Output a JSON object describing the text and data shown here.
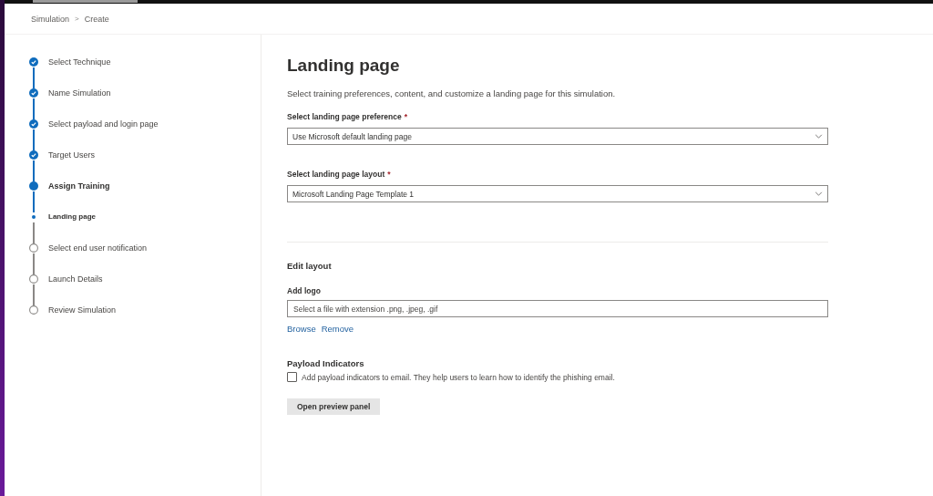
{
  "breadcrumb": [
    {
      "label": "Simulation"
    },
    {
      "label": "Create"
    }
  ],
  "breadcrumb_separator": ">",
  "steps": [
    {
      "label": "Select Technique",
      "kind": "step",
      "completed": true,
      "selected": false
    },
    {
      "label": "Name Simulation",
      "kind": "step",
      "completed": true,
      "selected": false
    },
    {
      "label": "Select payload and login page",
      "kind": "step",
      "completed": true,
      "selected": false
    },
    {
      "label": "Target Users",
      "kind": "step",
      "completed": true,
      "selected": false
    },
    {
      "label": "Assign Training",
      "kind": "step",
      "completed": false,
      "selected": true
    },
    {
      "label": "Landing page",
      "kind": "substep",
      "completed": false,
      "selected": true
    },
    {
      "label": "Select end user notification",
      "kind": "step",
      "completed": false,
      "selected": false
    },
    {
      "label": "Launch Details",
      "kind": "step",
      "completed": false,
      "selected": false
    },
    {
      "label": "Review Simulation",
      "kind": "step",
      "completed": false,
      "selected": false
    }
  ],
  "page": {
    "title": "Landing page",
    "description": "Select training preferences, content, and customize a landing page for this simulation."
  },
  "dropdowns": [
    {
      "label": "Select landing page preference",
      "required": true,
      "value": "Use Microsoft default landing page"
    },
    {
      "label": "Select landing page layout",
      "required": true,
      "value": "Microsoft Landing Page Template 1"
    }
  ],
  "required_mark": "*",
  "edit_layout": {
    "title": "Edit layout",
    "logo_label": "Add logo",
    "logo_placeholder": "Select a file with extension .png, .jpeg, .gif",
    "links": [
      "Browse",
      "Remove"
    ]
  },
  "payload_indicators": {
    "title": "Payload Indicators",
    "checkbox_label": "Add payload indicators to email. They help users to learn how to identify the phishing email.",
    "checked": false
  },
  "buttons": [
    "Open preview panel"
  ]
}
